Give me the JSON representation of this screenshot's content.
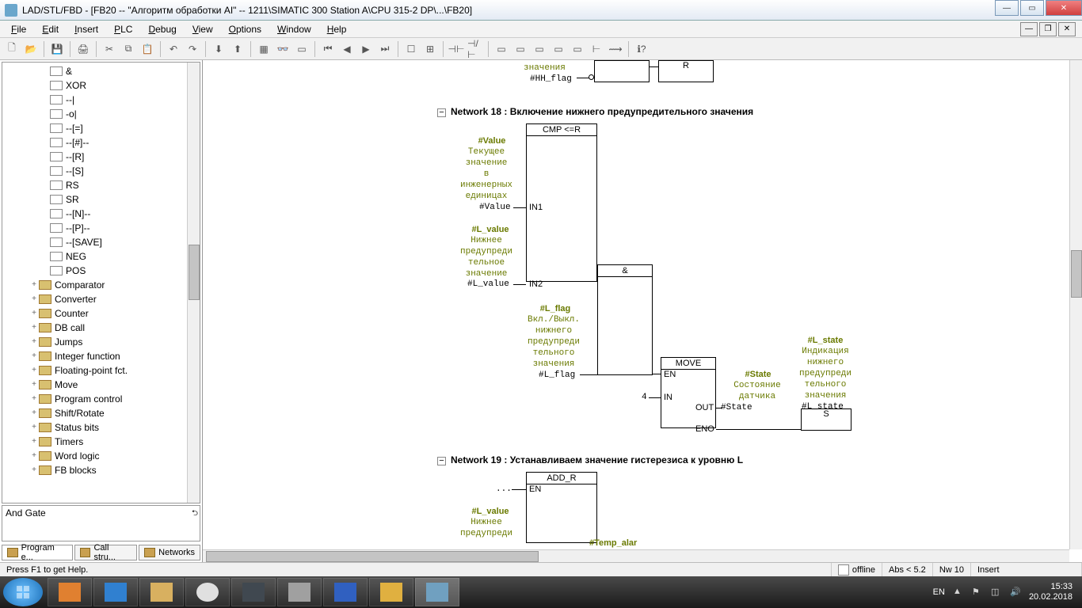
{
  "title": "LAD/STL/FBD  - [FB20 -- \"Алгоритм обработки AI\" -- 1211\\SIMATIC 300 Station A\\CPU 315-2 DP\\...\\FB20]",
  "menu": [
    "File",
    "Edit",
    "Insert",
    "PLC",
    "Debug",
    "View",
    "Options",
    "Window",
    "Help"
  ],
  "tree": {
    "items": [
      {
        "lvl": 2,
        "exp": "",
        "icon": "block",
        "label": "&"
      },
      {
        "lvl": 2,
        "exp": "",
        "icon": "block",
        "label": "XOR"
      },
      {
        "lvl": 2,
        "exp": "",
        "icon": "block",
        "label": "--|"
      },
      {
        "lvl": 2,
        "exp": "",
        "icon": "block",
        "label": "-o|"
      },
      {
        "lvl": 2,
        "exp": "",
        "icon": "block",
        "label": "--[=]"
      },
      {
        "lvl": 2,
        "exp": "",
        "icon": "block",
        "label": "--[#]--"
      },
      {
        "lvl": 2,
        "exp": "",
        "icon": "block",
        "label": "--[R]"
      },
      {
        "lvl": 2,
        "exp": "",
        "icon": "block",
        "label": "--[S]"
      },
      {
        "lvl": 2,
        "exp": "",
        "icon": "block",
        "label": "RS"
      },
      {
        "lvl": 2,
        "exp": "",
        "icon": "block",
        "label": "SR"
      },
      {
        "lvl": 2,
        "exp": "",
        "icon": "block",
        "label": "--[N]--"
      },
      {
        "lvl": 2,
        "exp": "",
        "icon": "block",
        "label": "--[P]--"
      },
      {
        "lvl": 2,
        "exp": "",
        "icon": "block",
        "label": "--[SAVE]"
      },
      {
        "lvl": 2,
        "exp": "",
        "icon": "block",
        "label": "NEG"
      },
      {
        "lvl": 2,
        "exp": "",
        "icon": "block",
        "label": "POS"
      },
      {
        "lvl": 1,
        "exp": "+",
        "icon": "folder",
        "label": "Comparator"
      },
      {
        "lvl": 1,
        "exp": "+",
        "icon": "folder",
        "label": "Converter"
      },
      {
        "lvl": 1,
        "exp": "+",
        "icon": "folder",
        "label": "Counter"
      },
      {
        "lvl": 1,
        "exp": "+",
        "icon": "folder",
        "label": "DB call"
      },
      {
        "lvl": 1,
        "exp": "+",
        "icon": "folder",
        "label": "Jumps"
      },
      {
        "lvl": 1,
        "exp": "+",
        "icon": "folder",
        "label": "Integer function"
      },
      {
        "lvl": 1,
        "exp": "+",
        "icon": "folder",
        "label": "Floating-point fct."
      },
      {
        "lvl": 1,
        "exp": "+",
        "icon": "folder",
        "label": "Move"
      },
      {
        "lvl": 1,
        "exp": "+",
        "icon": "folder",
        "label": "Program control"
      },
      {
        "lvl": 1,
        "exp": "+",
        "icon": "folder",
        "label": "Shift/Rotate"
      },
      {
        "lvl": 1,
        "exp": "+",
        "icon": "folder",
        "label": "Status bits"
      },
      {
        "lvl": 1,
        "exp": "+",
        "icon": "folder",
        "label": "Timers"
      },
      {
        "lvl": 1,
        "exp": "+",
        "icon": "folder",
        "label": "Word logic"
      },
      {
        "lvl": 1,
        "exp": "+",
        "icon": "folder",
        "label": "FB blocks"
      }
    ]
  },
  "local": "And Gate",
  "tabs": [
    {
      "label": "Program e...",
      "active": true
    },
    {
      "label": "Call stru...",
      "active": false
    },
    {
      "label": "Networks",
      "active": false
    }
  ],
  "editor": {
    "top_frag": {
      "l1": "значения",
      "l2": "#HH_flag",
      "r": "R"
    },
    "net18": {
      "title": "Network 18 : Включение нижнего предупредительного значения",
      "cmp": "CMP <=R",
      "value_head": "#Value",
      "value_desc": [
        "Текущее",
        "значение",
        "в",
        "инженерных",
        "единицах"
      ],
      "value_sig": "#Value",
      "in1": "IN1",
      "lval_head": "#L_value",
      "lval_desc": [
        "Нижнее",
        "предупреди",
        "тельное",
        "значение"
      ],
      "lval_sig": "#L_value",
      "in2": "IN2",
      "and": "&",
      "lflag_head": "#L_flag",
      "lflag_desc": [
        "Вкл./Выкл.",
        "нижнего",
        "предупреди",
        "тельного",
        "значения"
      ],
      "lflag_sig": "#L_flag",
      "move": "MOVE",
      "en": "EN",
      "in": "IN",
      "four": "4",
      "out": "OUT",
      "eno": "ENO",
      "state_head": "#State",
      "state_desc": [
        "Состояние",
        "датчика"
      ],
      "state_sig": "#State",
      "lstate_head": "#L_state",
      "lstate_desc": [
        "Индикация",
        "нижнего",
        "предупреди",
        "тельного",
        "значения"
      ],
      "lstate_sig": "#L_state",
      "s": "S"
    },
    "net19": {
      "title": "Network 19 : Устанавливаем значение гистерезиса к уровню L",
      "addr": "ADD_R",
      "en": "EN",
      "ell": "...",
      "lval_head": "#L_value",
      "lval_desc": [
        "Нижнее",
        "предупреди"
      ],
      "temp": "#Temp_alar"
    }
  },
  "status": {
    "help": "Press F1 to get Help.",
    "offline": "offline",
    "abs": "Abs < 5.2",
    "nw": "Nw 10",
    "insert": "Insert"
  },
  "tray": {
    "lang": "EN",
    "time": "15:33",
    "date": "20.02.2018"
  }
}
